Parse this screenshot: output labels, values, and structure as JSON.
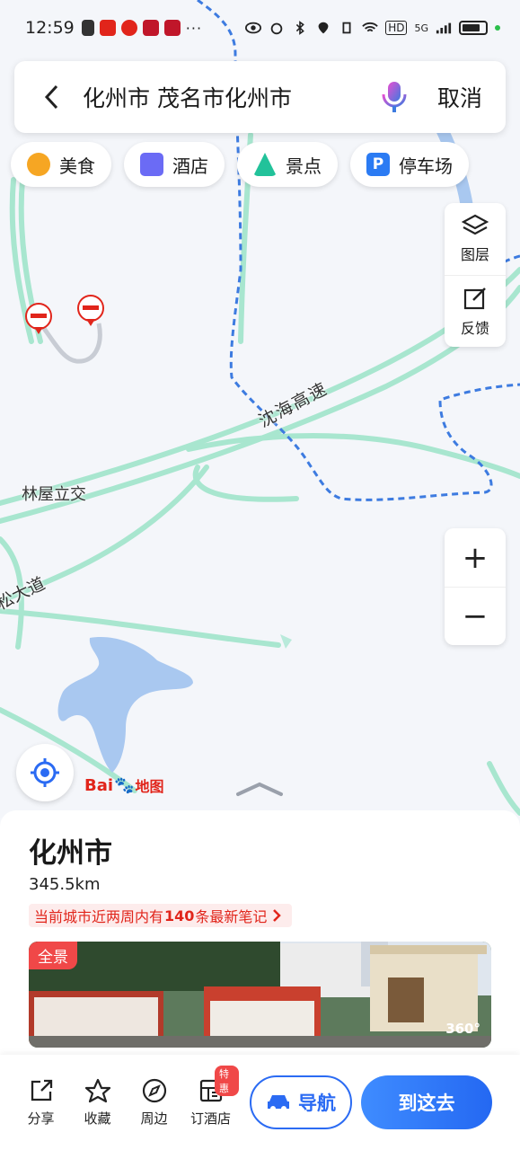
{
  "status_bar": {
    "time": "12:59",
    "dots": "···",
    "network": "5G"
  },
  "search": {
    "query": "化州市 茂名市化州市",
    "cancel_label": "取消"
  },
  "categories": [
    {
      "label": "美食",
      "icon": "food-icon",
      "color": "#f6a623"
    },
    {
      "label": "酒店",
      "icon": "hotel-icon",
      "color": "#6b6bf5"
    },
    {
      "label": "景点",
      "icon": "scenic-icon",
      "color": "#22c29a"
    },
    {
      "label": "停车场",
      "icon": "parking-icon",
      "color": "#2b7bf3"
    }
  ],
  "tools": {
    "layers_label": "图层",
    "feedback_label": "反馈"
  },
  "map": {
    "labels": {
      "expressway": "沈海高速",
      "interchange": "林屋立交",
      "avenue": "松大道"
    }
  },
  "logo": {
    "text_a": "Bai",
    "text_b": "地图"
  },
  "place": {
    "name": "化州市",
    "distance": "345.5km",
    "notes_prefix": "当前城市近两周内有",
    "notes_count": "140",
    "notes_suffix": "条最新笔记",
    "pano_badge": "全景",
    "pano_360": "360°"
  },
  "actions": {
    "share": "分享",
    "favorite": "收藏",
    "nearby": "周边",
    "book_hotel": "订酒店",
    "hotel_badge": "特惠",
    "navigate": "导航",
    "go_here": "到这去"
  },
  "colors": {
    "accent": "#2b6bf3",
    "road": "#a8e6cf",
    "water": "#a9c8f0",
    "boundary": "#3d7be0"
  }
}
